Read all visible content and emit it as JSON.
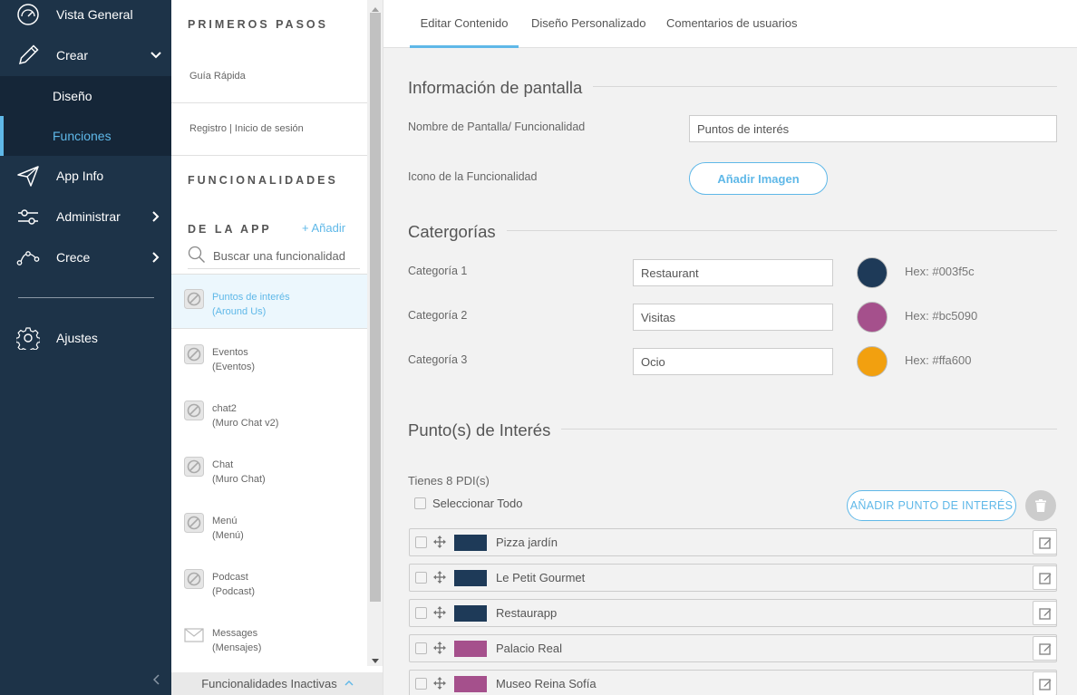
{
  "nav": {
    "overview": "Vista General",
    "create": "Crear",
    "design": "Diseño",
    "functions": "Funciones",
    "app_info": "App Info",
    "admin": "Administrar",
    "grow": "Crece",
    "settings": "Ajustes"
  },
  "middle": {
    "first_steps_title": "PRIMEROS PASOS",
    "quick_guide": "Guía Rápida",
    "register_login": "Registro | Inicio de sesión",
    "features_title": "FUNCIONALIDADES",
    "app_title": "DE LA APP",
    "add_label": "+ Añadir",
    "search_placeholder": "Buscar una funcionalidad",
    "features": [
      {
        "name": "Puntos de interés",
        "sub": "(Around Us)",
        "icon": "disabled-icon"
      },
      {
        "name": "Eventos",
        "sub": "(Eventos)",
        "icon": "disabled-icon"
      },
      {
        "name": "chat2",
        "sub": "(Muro Chat v2)",
        "icon": "disabled-icon"
      },
      {
        "name": "Chat",
        "sub": "(Muro Chat)",
        "icon": "disabled-icon"
      },
      {
        "name": "Menú",
        "sub": "(Menú)",
        "icon": "disabled-icon"
      },
      {
        "name": "Podcast",
        "sub": "(Podcast)",
        "icon": "disabled-icon"
      },
      {
        "name": "Messages",
        "sub": "(Mensajes)",
        "icon": "envelope-icon"
      }
    ],
    "inactive_label": "Funcionalidades Inactivas"
  },
  "tabs": {
    "edit": "Editar Contenido",
    "design": "Diseño Personalizado",
    "comments": "Comentarios de usuarios"
  },
  "screen_info": {
    "title": "Información de pantalla",
    "name_label": "Nombre de Pantalla/ Funcionalidad",
    "name_value": "Puntos de interés",
    "icon_label": "Icono de la Funcionalidad",
    "add_image": "Añadir Imagen"
  },
  "categories": {
    "title": "Catergorías",
    "items": [
      {
        "label": "Categoría 1",
        "value": "Restaurant",
        "color": "#1e3a58",
        "hex": "Hex: #003f5c"
      },
      {
        "label": "Categoría 2",
        "value": "Visitas",
        "color": "#a5508c",
        "hex": "Hex: #bc5090"
      },
      {
        "label": "Categoría 3",
        "value": "Ocio",
        "color": "#f2a00f",
        "hex": "Hex: #ffa600"
      }
    ]
  },
  "poi": {
    "title": "Punto(s) de Interés",
    "count": "Tienes 8 PDI(s)",
    "select_all": "Seleccionar Todo",
    "add_button": "AÑADIR PUNTO DE INTERÉS",
    "items": [
      {
        "name": "Pizza jardín",
        "color": "#1e3a58"
      },
      {
        "name": "Le Petit Gourmet",
        "color": "#1e3a58"
      },
      {
        "name": "Restaurapp",
        "color": "#1e3a58"
      },
      {
        "name": "Palacio Real",
        "color": "#a5508c"
      },
      {
        "name": "Museo Reina Sofía",
        "color": "#a5508c"
      }
    ]
  },
  "colors": {
    "nav_bg": "#1d3348",
    "accent": "#5fb8e8"
  }
}
